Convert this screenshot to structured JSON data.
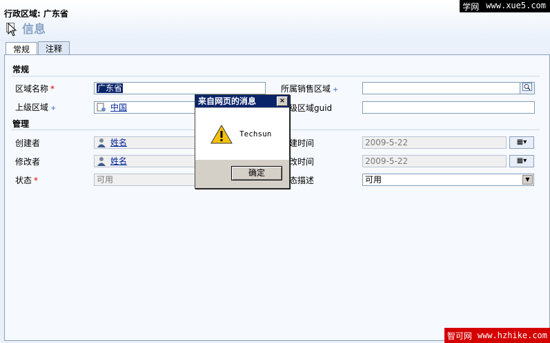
{
  "header": {
    "title": "行政区域: 广东省",
    "subtitle": "信息"
  },
  "watermark_top": {
    "name": "学网",
    "url": "www.xue5.com"
  },
  "tabs": [
    {
      "label": "常规",
      "active": true
    },
    {
      "label": "注释",
      "active": false
    }
  ],
  "sections": {
    "general": "常规",
    "management": "管理"
  },
  "fields": {
    "region_name": {
      "label": "区域名称",
      "marker": "*",
      "value": "广东省"
    },
    "sales_region": {
      "label": "所属销售区域",
      "marker": "+",
      "value": ""
    },
    "parent_region": {
      "label": "上级区域",
      "marker": "+",
      "value": "中国"
    },
    "parent_guid": {
      "label": "上级区域guid",
      "value": ""
    },
    "created_by": {
      "label": "创建者",
      "value": "姓名"
    },
    "created_on": {
      "label": "创建时间",
      "value": "2009-5-22"
    },
    "modified_by": {
      "label": "修改者",
      "value": "姓名"
    },
    "modified_on": {
      "label": "修改时间",
      "value": "2009-5-22"
    },
    "status": {
      "label": "状态",
      "marker": "*",
      "value": "可用"
    },
    "status_reason": {
      "label": "状态描述",
      "value": "可用"
    }
  },
  "dialog": {
    "title": "来自网页的消息",
    "message": "Techsun",
    "ok_label": "确定",
    "close_glyph": "×"
  },
  "watermark_bottom": {
    "name": "智可网",
    "url": "www.hzhike.com"
  }
}
